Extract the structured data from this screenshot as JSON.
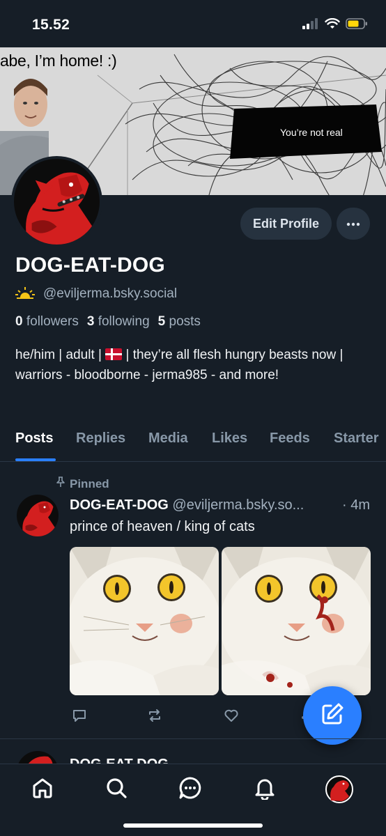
{
  "status_bar": {
    "time": "15.52"
  },
  "banner": {
    "caption": "abe, I’m home! :)",
    "redacted_text": "You’re not real"
  },
  "profile": {
    "edit_label": "Edit Profile",
    "display_name": "DOG-EAT-DOG",
    "handle": "@eviljerma.bsky.social",
    "followers_count": "0",
    "followers_label": "followers",
    "following_count": "3",
    "following_label": "following",
    "posts_count": "5",
    "posts_label": "posts",
    "bio_part1": "he/him | adult | ",
    "bio_part2": " | they’re all flesh hungry beasts now | warriors - bloodborne - jerma985 - and more!"
  },
  "tabs": [
    {
      "label": "Posts",
      "active": true
    },
    {
      "label": "Replies",
      "active": false
    },
    {
      "label": "Media",
      "active": false
    },
    {
      "label": "Likes",
      "active": false
    },
    {
      "label": "Feeds",
      "active": false
    },
    {
      "label": "Starter",
      "active": false
    }
  ],
  "post": {
    "pinned_label": "Pinned",
    "author": "DOG-EAT-DOG",
    "handle": "@eviljerma.bsky.so...",
    "time": "· 4m",
    "text": "prince of heaven / king of cats"
  },
  "next_post": {
    "author": "DOG-EAT-DOG"
  },
  "colors": {
    "background": "#161e27",
    "accent": "#2a7fff",
    "secondary_text": "#a3b1bf",
    "avatar_red": "#d31f1f"
  },
  "icons": [
    "wifi-icon",
    "battery-icon",
    "cellular-icon",
    "sun-icon",
    "pin-icon",
    "reply-icon",
    "repost-icon",
    "like-icon",
    "compose-icon",
    "home-icon",
    "search-icon",
    "chat-icon",
    "bell-icon"
  ]
}
